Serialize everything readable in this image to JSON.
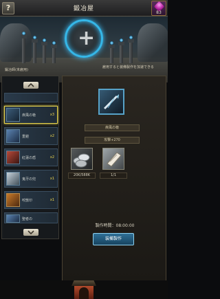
{
  "header": {
    "title": "鍛冶屋",
    "help_label": "?",
    "gem_count": "83"
  },
  "scene": {
    "left_text": "鍛冶師(未雇用)",
    "right_text": "雇用すると装備製作を加速できる",
    "slot_label": "+"
  },
  "list": {
    "items": [
      {
        "name": "",
        "count": ""
      },
      {
        "name": "疾風の槍",
        "count": "x3",
        "color": "blue",
        "selected": true
      },
      {
        "name": "重鎧",
        "count": "x2",
        "color": "blue"
      },
      {
        "name": "紅蓮の盾",
        "count": "x2",
        "color": "red"
      },
      {
        "name": "鬼牙の兜",
        "count": "x1",
        "color": "white"
      },
      {
        "name": "咬獣印",
        "count": "x1",
        "color": "orange"
      },
      {
        "name": "聖者の",
        "count": "",
        "color": "blue"
      }
    ]
  },
  "detail": {
    "item_name": "疾風の槍",
    "stat": "攻撃+270",
    "materials": [
      {
        "icon": "coins-icon",
        "amount": "20K/588K"
      },
      {
        "icon": "scroll-icon",
        "amount": "1/1"
      }
    ],
    "craft_time": "製作時間：08:00:00",
    "craft_button": "装備製作"
  },
  "colors": {
    "accent": "#35b7e8",
    "selected": "#e6d24b",
    "count": "#f0d850"
  }
}
